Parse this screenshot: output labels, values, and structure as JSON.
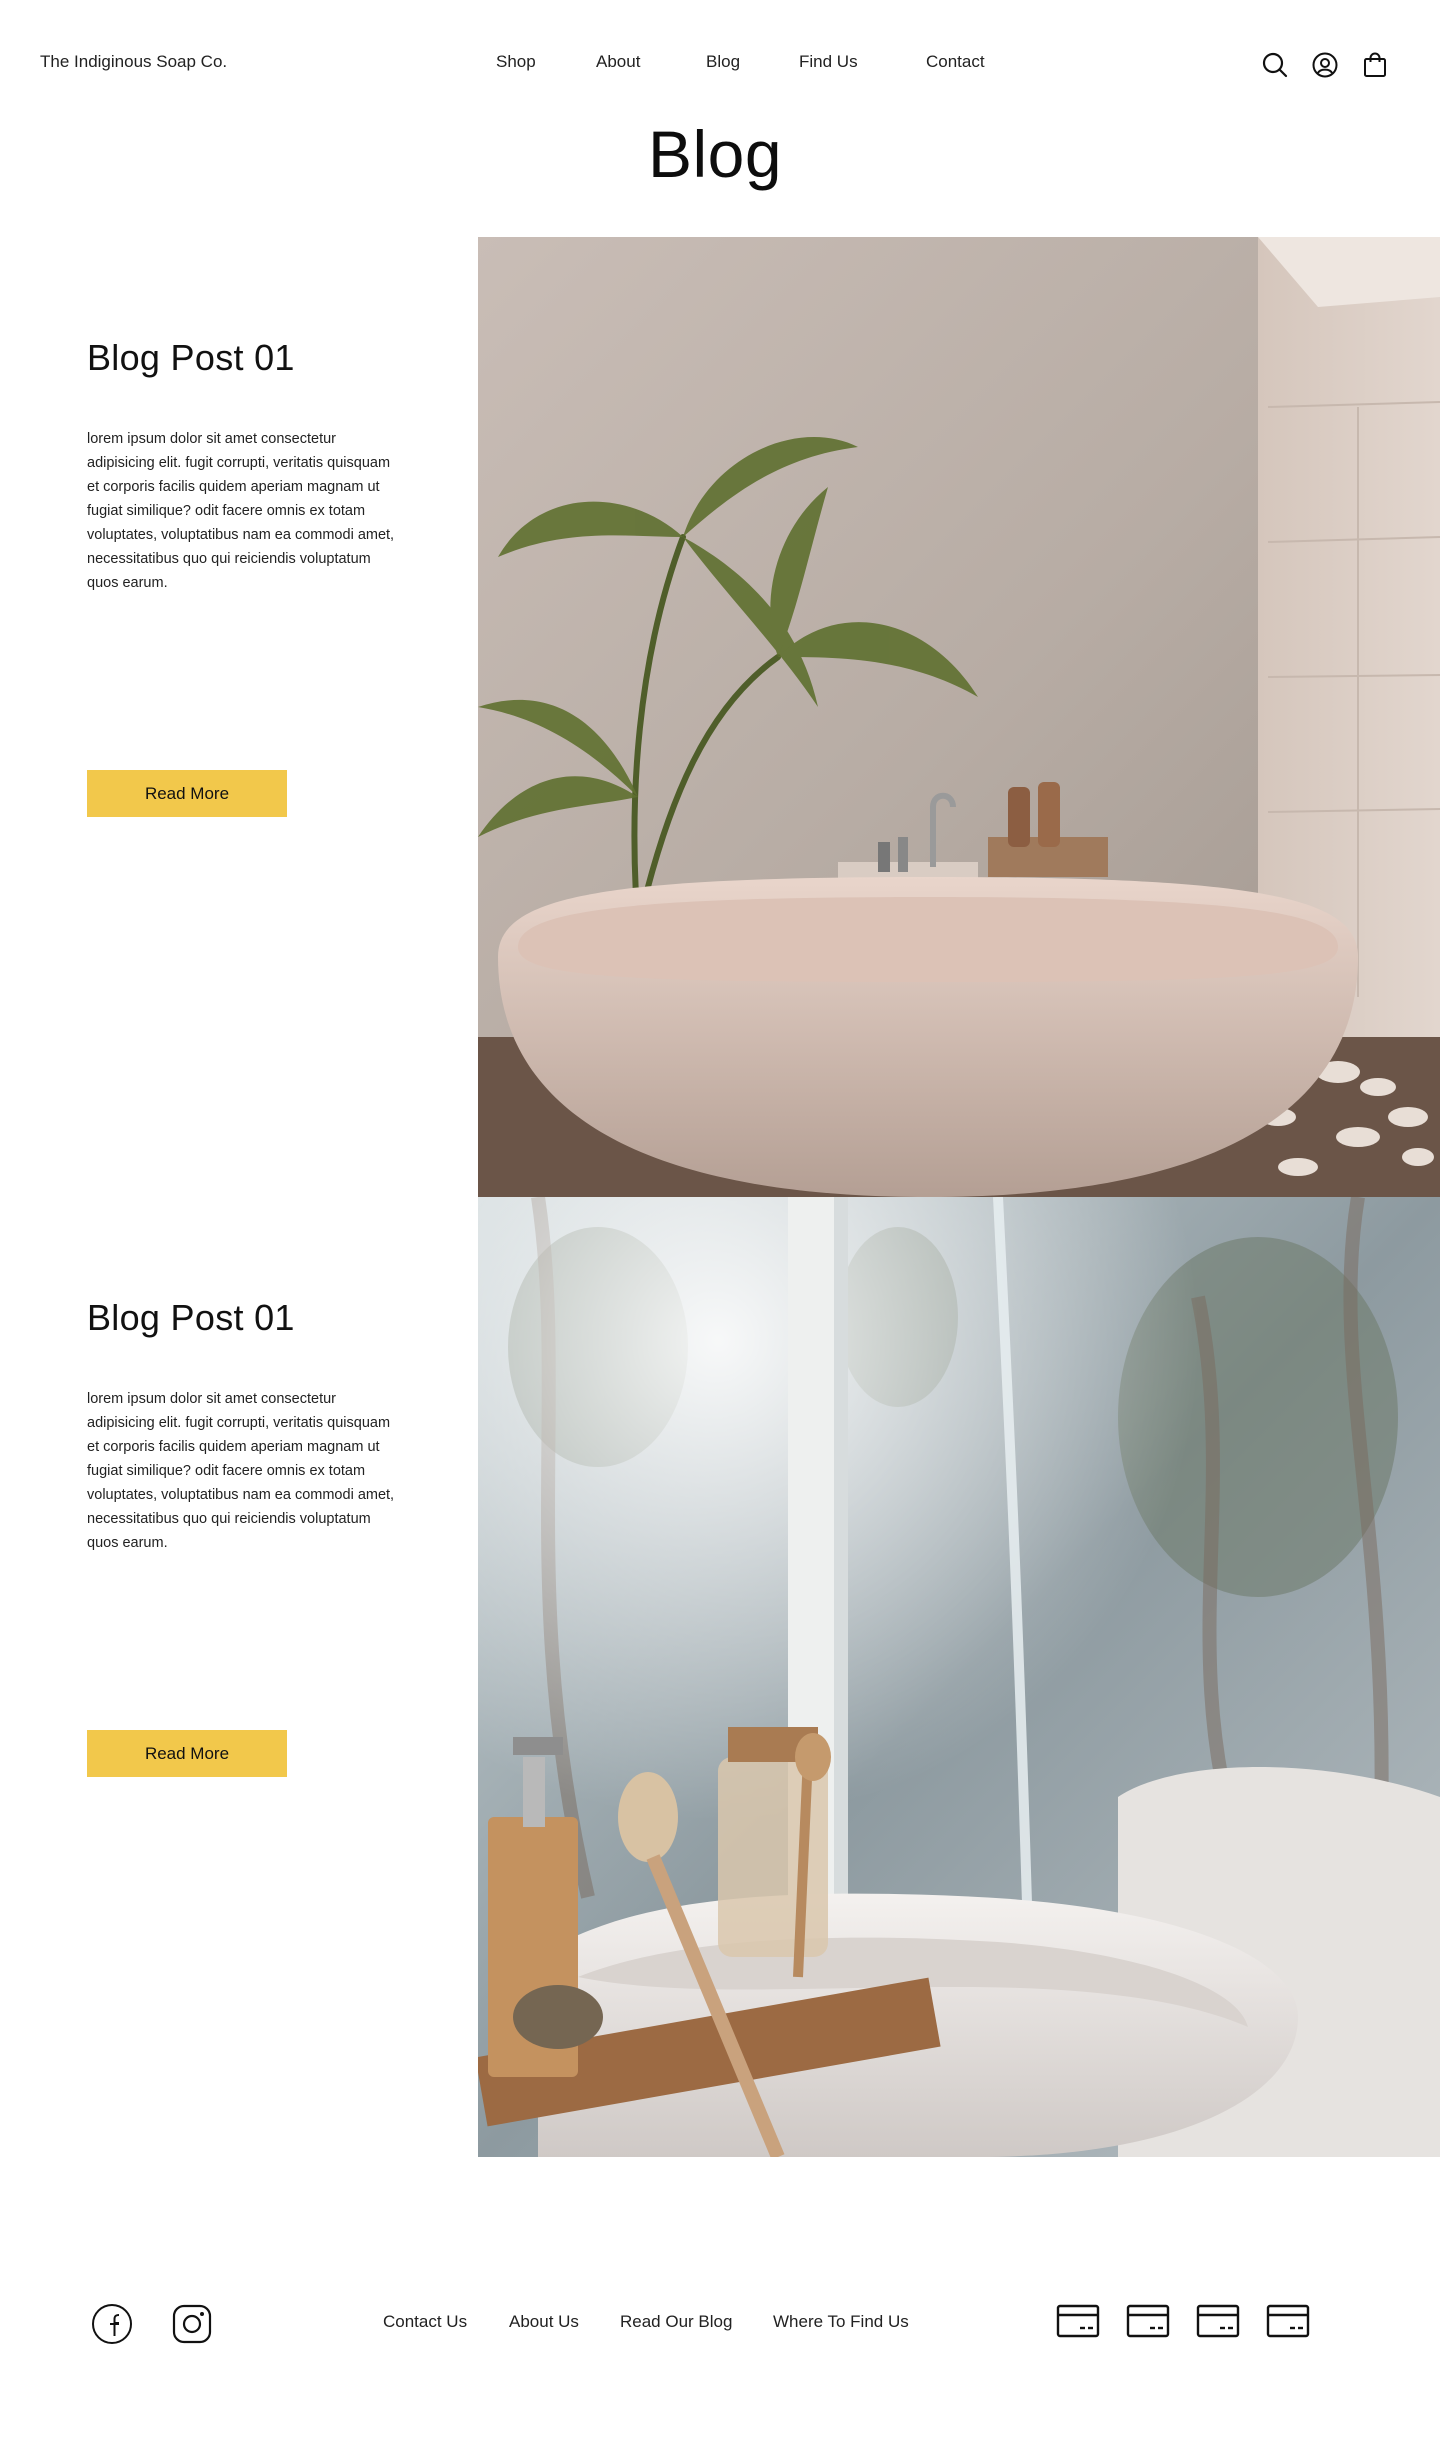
{
  "header": {
    "brand": "The Indiginous Soap Co.",
    "nav": [
      "Shop",
      "About",
      "Blog",
      "Find Us",
      "Contact"
    ],
    "icons": [
      "search-icon",
      "account-icon",
      "cart-icon"
    ]
  },
  "page": {
    "title": "Blog"
  },
  "posts": [
    {
      "title": "Blog Post 01",
      "body": "lorem ipsum dolor sit amet consectetur adipisicing elit. fugit corrupti, veritatis quisquam et corporis facilis quidem aperiam magnam ut fugiat similique? odit facere omnis ex totam voluptates, voluptatibus nam ea commodi amet, necessitatibus quo qui reiciendis voluptatum quos earum.",
      "button": "Read More"
    },
    {
      "title": "Blog Post 01",
      "body": "lorem ipsum dolor sit amet consectetur adipisicing elit. fugit corrupti, veritatis quisquam et corporis facilis quidem aperiam magnam ut fugiat similique? odit facere omnis ex totam voluptates, voluptatibus nam ea commodi amet, necessitatibus quo qui reiciendis voluptatum quos earum.",
      "button": "Read More"
    }
  ],
  "footer": {
    "social": [
      "facebook-icon",
      "instagram-icon"
    ],
    "links": [
      "Contact Us",
      "About Us",
      "Read Our Blog",
      "Where To Find Us"
    ],
    "payment_icons": [
      "card-icon",
      "card-icon",
      "card-icon",
      "card-icon"
    ]
  },
  "colors": {
    "accent": "#f2c84b",
    "text": "#1a1a1a",
    "background": "#ffffff"
  }
}
